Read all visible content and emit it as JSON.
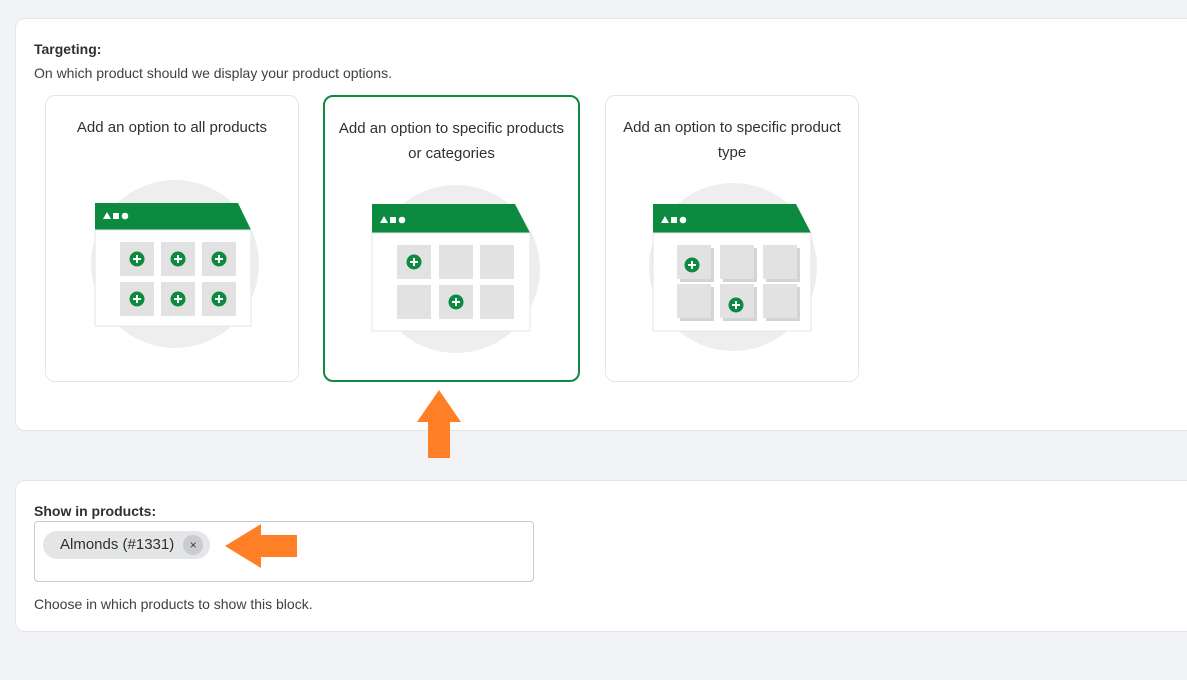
{
  "targeting": {
    "title": "Targeting:",
    "subtitle": "On which product should we display your product options.",
    "options": [
      {
        "label": "Add an option to all products",
        "selected": false,
        "icon": "all-products-illustration"
      },
      {
        "label": "Add an option to specific products or categories",
        "selected": true,
        "icon": "specific-products-illustration"
      },
      {
        "label": "Add an option to specific product type",
        "selected": false,
        "icon": "product-type-illustration"
      }
    ]
  },
  "products": {
    "title": "Show in products:",
    "tags": [
      {
        "label": "Almonds (#1331)",
        "remove_symbol": "×"
      }
    ],
    "help": "Choose in which products to show this block."
  },
  "colors": {
    "accent_green": "#0c8a3f",
    "annotation_orange": "#ff7f27"
  }
}
